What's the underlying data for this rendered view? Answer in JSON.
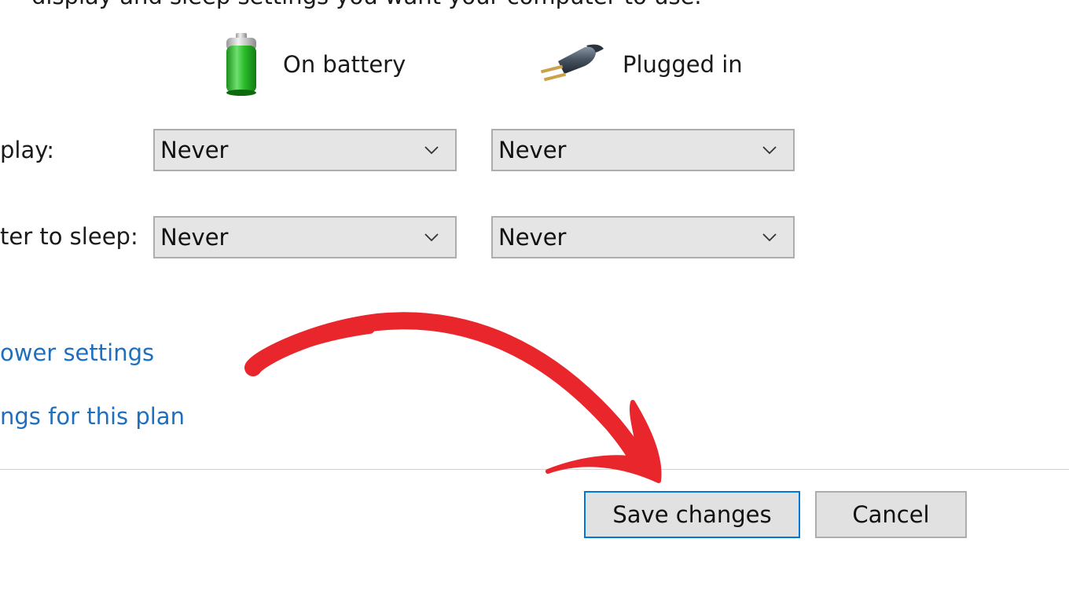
{
  "top_cut_text": "display and sleep settings you want your computer to use.",
  "columns": {
    "battery": {
      "label": "On battery",
      "icon": "battery-icon"
    },
    "plugged": {
      "label": "Plugged in",
      "icon": "plug-icon"
    }
  },
  "rows": [
    {
      "label": "play:",
      "on_battery": "Never",
      "plugged_in": "Never"
    },
    {
      "label": "ter to sleep:",
      "on_battery": "Never",
      "plugged_in": "Never"
    }
  ],
  "links": [
    {
      "label": "ower settings"
    },
    {
      "label": "ngs for this plan"
    }
  ],
  "buttons": {
    "save": "Save changes",
    "cancel": "Cancel"
  },
  "annotation": {
    "icon": "red-curved-arrow-icon",
    "color": "#e8262c"
  },
  "colors": {
    "link": "#1f6fbf",
    "focus_border": "#0078d7",
    "dropdown_bg": "#e5e5e5"
  }
}
